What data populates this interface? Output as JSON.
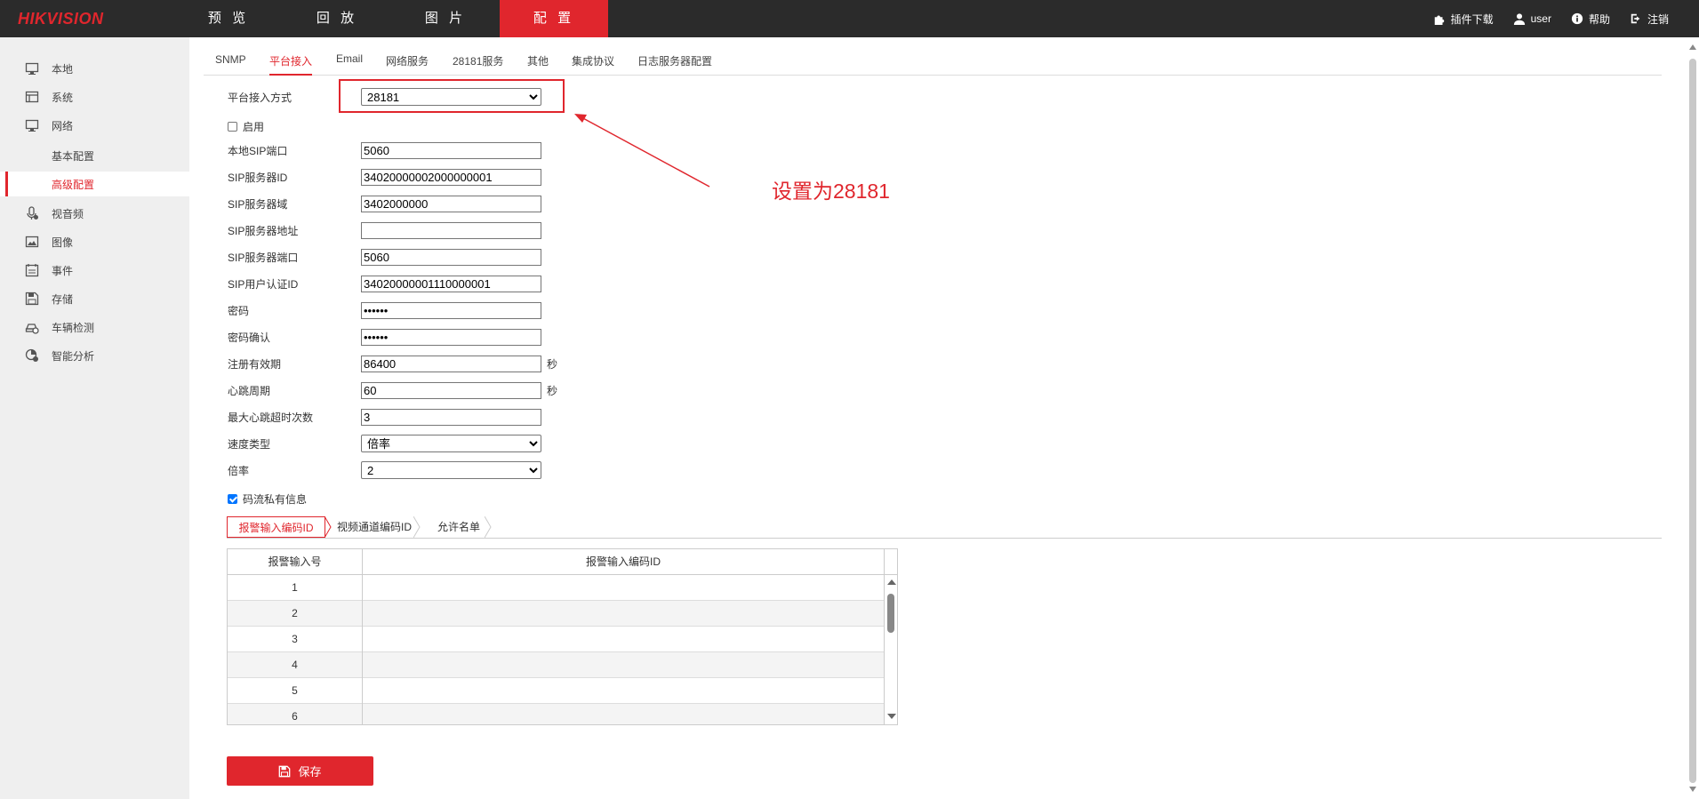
{
  "brand": {
    "logo": "HIKVISION",
    "accent": "#e0262d",
    "topbar_bg": "#2b2b2b"
  },
  "nav": [
    {
      "label": "预 览"
    },
    {
      "label": "回 放"
    },
    {
      "label": "图 片"
    },
    {
      "label": "配 置"
    }
  ],
  "top_right": {
    "plugin": "插件下载",
    "user": "user",
    "help": "帮助",
    "logout": "注销"
  },
  "sidebar": [
    {
      "label": "本地",
      "icon": "monitor-icon"
    },
    {
      "label": "系统",
      "icon": "system-icon"
    },
    {
      "label": "网络",
      "icon": "network-icon"
    },
    {
      "label": "基本配置"
    },
    {
      "label": "高级配置"
    },
    {
      "label": "视音频",
      "icon": "microphone-icon"
    },
    {
      "label": "图像",
      "icon": "image-icon"
    },
    {
      "label": "事件",
      "icon": "calendar-icon"
    },
    {
      "label": "存储",
      "icon": "save-icon"
    },
    {
      "label": "车辆检测",
      "icon": "car-icon"
    },
    {
      "label": "智能分析",
      "icon": "analysis-icon"
    }
  ],
  "tabs": [
    "SNMP",
    "平台接入",
    "Email",
    "网络服务",
    "28181服务",
    "其他",
    "集成协议",
    "日志服务器配置"
  ],
  "form": {
    "access_mode_label": "平台接入方式",
    "access_mode_value": "28181",
    "enable_label": "启用",
    "local_sip_port_label": "本地SIP端口",
    "local_sip_port": "5060",
    "sip_server_id_label": "SIP服务器ID",
    "sip_server_id": "34020000002000000001",
    "sip_server_domain_label": "SIP服务器域",
    "sip_server_domain": "3402000000",
    "sip_server_addr_label": "SIP服务器地址",
    "sip_server_addr": "",
    "sip_server_port_label": "SIP服务器端口",
    "sip_server_port": "5060",
    "sip_user_id_label": "SIP用户认证ID",
    "sip_user_id": "34020000001110000001",
    "password_label": "密码",
    "password": "••••••",
    "password_confirm_label": "密码确认",
    "password_confirm": "••••••",
    "reg_valid_label": "注册有效期",
    "reg_valid": "86400",
    "heartbeat_label": "心跳周期",
    "heartbeat": "60",
    "seconds_unit": "秒",
    "max_timeout_label": "最大心跳超时次数",
    "max_timeout": "3",
    "speed_type_label": "速度类型",
    "speed_type": "倍率",
    "rate_label": "倍率",
    "rate": "2",
    "stream_private_label": "码流私有信息"
  },
  "annotation": "设置为28181",
  "subtabs": [
    "报警输入编码ID",
    "视频通道编码ID",
    "允许名单"
  ],
  "table": {
    "headers": [
      "报警输入号",
      "报警输入编码ID"
    ],
    "rows": [
      "1",
      "2",
      "3",
      "4",
      "5",
      "6"
    ]
  },
  "save_label": "保存"
}
